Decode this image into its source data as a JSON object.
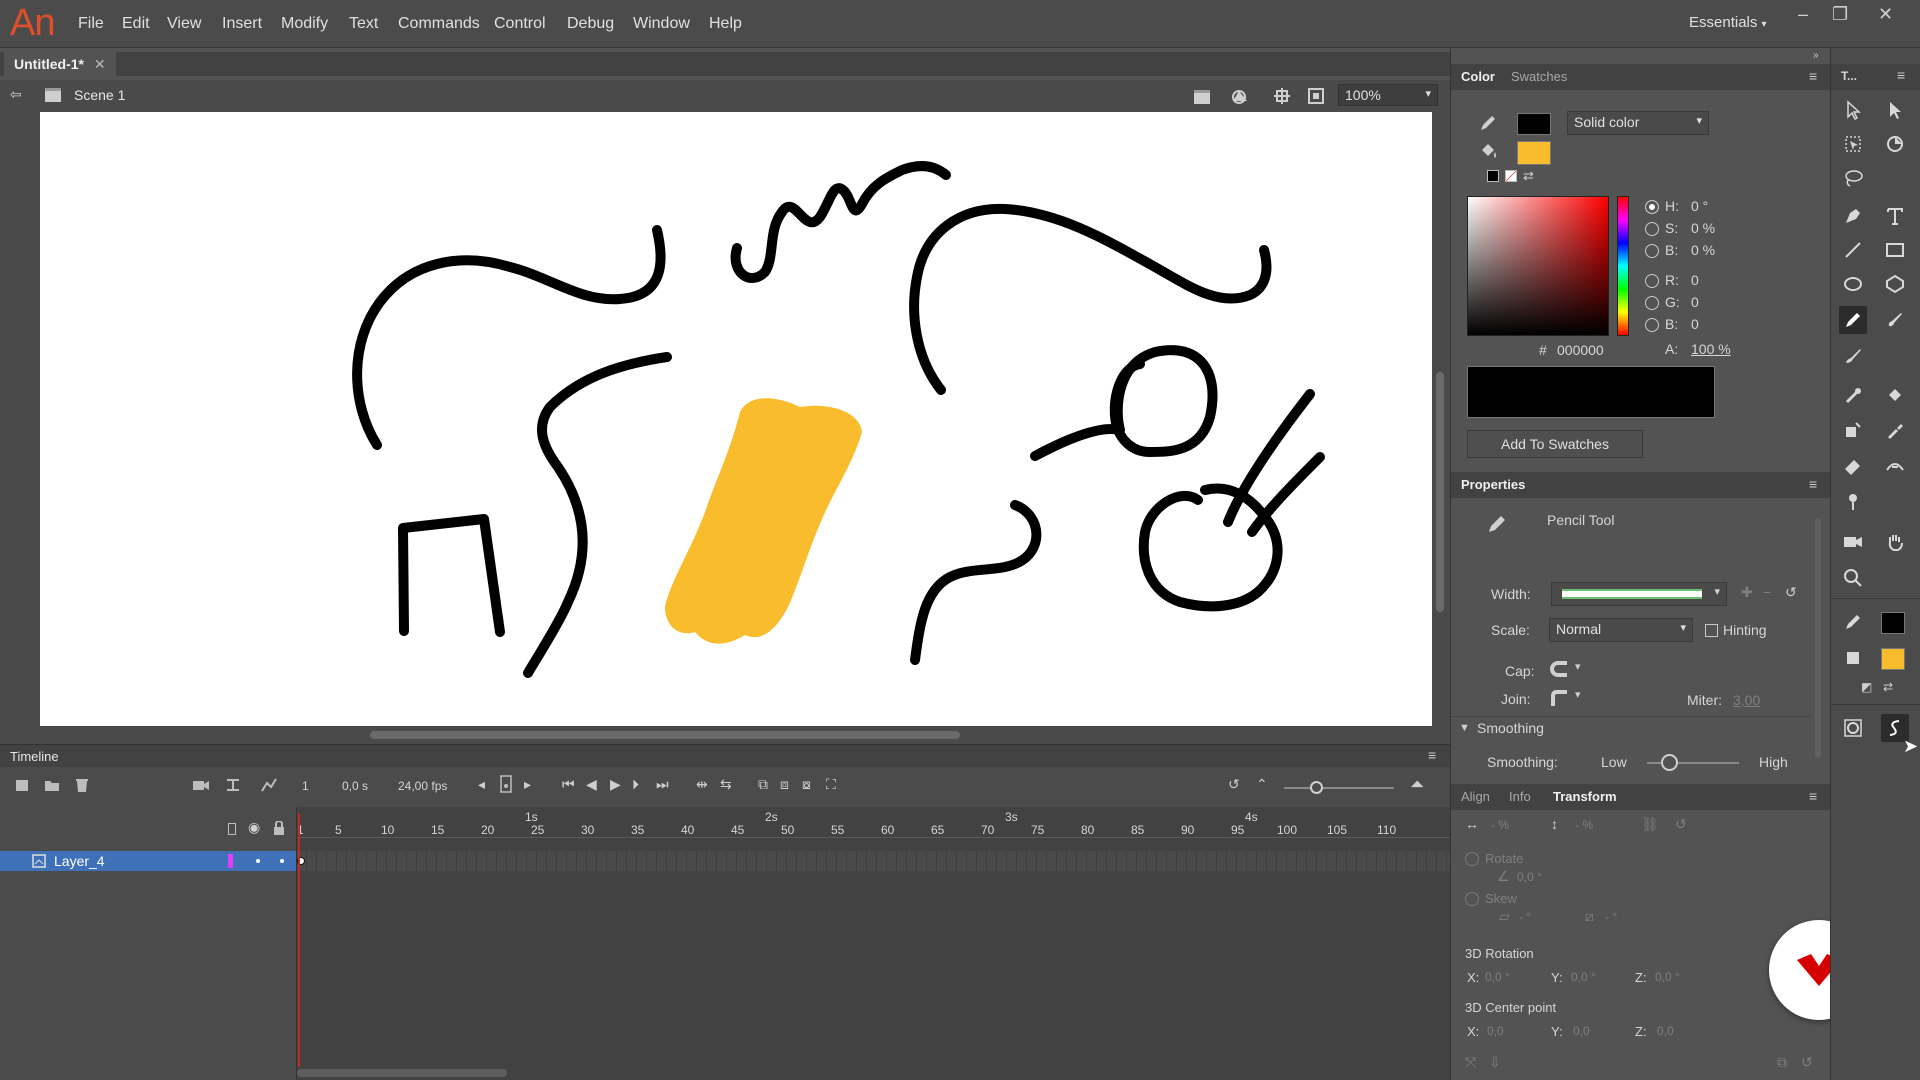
{
  "app": {
    "logo": "An",
    "menu": [
      "File",
      "Edit",
      "View",
      "Insert",
      "Modify",
      "Text",
      "Commands",
      "Control",
      "Debug",
      "Window",
      "Help"
    ],
    "workspace": "Essentials"
  },
  "document": {
    "tab_title": "Untitled-1*",
    "scene": "Scene 1",
    "zoom": "100%"
  },
  "timeline": {
    "panel_title": "Timeline",
    "frame": "1",
    "time": "0,0 s",
    "fps": "24,00 fps",
    "seconds": [
      "1s",
      "2s",
      "3s",
      "4s"
    ],
    "frame_numbers": [
      "1",
      "5",
      "10",
      "15",
      "20",
      "25",
      "30",
      "35",
      "40",
      "45",
      "50",
      "55",
      "60",
      "65",
      "70",
      "75",
      "80",
      "85",
      "90",
      "95",
      "100",
      "105",
      "110"
    ],
    "layer_name": "Layer_4"
  },
  "color_panel": {
    "tabs": [
      "Color",
      "Swatches"
    ],
    "fill_type": "Solid color",
    "stroke_color": "#000000",
    "fill_color": "#F8BC2C",
    "h_label": "H:",
    "h": "0 °",
    "s_label": "S:",
    "s": "0 %",
    "b_label": "B:",
    "b": "0 %",
    "r_label": "R:",
    "r": "0",
    "g_label": "G:",
    "g": "0",
    "bl_label": "B:",
    "bl": "0",
    "hex_label": "#",
    "hex": "000000",
    "alpha_label": "A:",
    "alpha": "100 %",
    "add_swatch": "Add To Swatches"
  },
  "properties": {
    "panel_title": "Properties",
    "tool_name": "Pencil Tool",
    "width_label": "Width:",
    "scale_label": "Scale:",
    "scale": "Normal",
    "hinting": "Hinting",
    "cap_label": "Cap:",
    "join_label": "Join:",
    "miter_label": "Miter:",
    "miter": "3,00",
    "smoothing_section": "Smoothing",
    "smoothing_label": "Smoothing:",
    "low": "Low",
    "high": "High"
  },
  "transform_panel": {
    "tabs": [
      "Align",
      "Info",
      "Transform"
    ],
    "width_pct": "- %",
    "height_pct": "- %",
    "rotate": "Rotate",
    "rotate_val": "0,0 °",
    "skew": "Skew",
    "skew_h": "- °",
    "skew_v": "- °",
    "rotation_3d": "3D Rotation",
    "center_3d": "3D Center point",
    "x_label": "X:",
    "y_label": "Y:",
    "z_label": "Z:",
    "rx": "0,0 °",
    "ry": "0,0 °",
    "rz": "0,0 °",
    "cx": "0,0",
    "cy": "0,0",
    "cz": "0,0"
  },
  "tools_panel": {
    "title": "T..."
  }
}
